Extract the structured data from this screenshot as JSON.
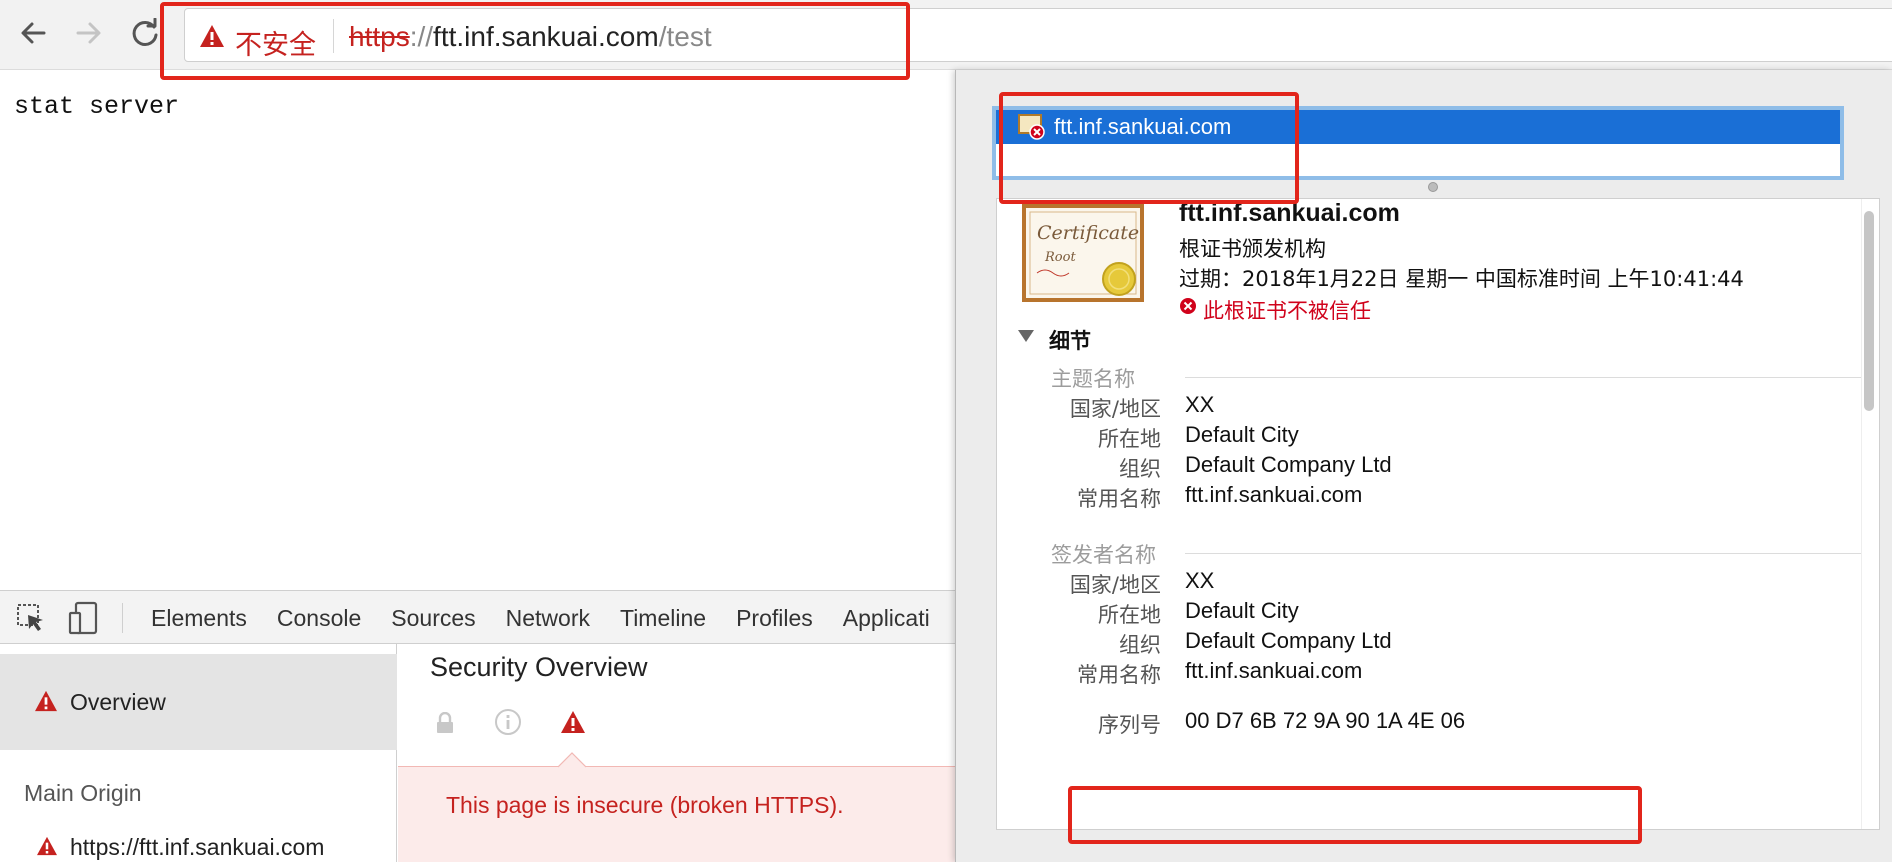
{
  "browser": {
    "security_label": "不安全",
    "url_scheme": "https",
    "url_separator": "://",
    "url_host": "ftt.inf.sankuai.com",
    "url_path": "/test"
  },
  "page": {
    "body_text": "stat server"
  },
  "devtools": {
    "tabs": [
      "Elements",
      "Console",
      "Sources",
      "Network",
      "Timeline",
      "Profiles",
      "Applicati"
    ],
    "sidebar": {
      "overview_label": "Overview",
      "main_origin_label": "Main Origin",
      "origin_url": "https://ftt.inf.sankuai.com"
    },
    "security": {
      "title": "Security Overview",
      "message": "This page is insecure (broken HTTPS)."
    }
  },
  "certificate": {
    "list_item": "ftt.inf.sankuai.com",
    "name": "ftt.inf.sankuai.com",
    "kind": "根证书颁发机构",
    "expiry": "过期：2018年1月22日 星期一 中国标准时间 上午10:41:44",
    "trust_status": "此根证书不被信任",
    "details_label": "细节",
    "subject": {
      "heading": "主题名称",
      "rows": [
        {
          "label": "国家/地区",
          "value": "XX"
        },
        {
          "label": "所在地",
          "value": "Default City"
        },
        {
          "label": "组织",
          "value": "Default Company Ltd"
        },
        {
          "label": "常用名称",
          "value": "ftt.inf.sankuai.com"
        }
      ]
    },
    "issuer": {
      "heading": "签发者名称",
      "rows": [
        {
          "label": "国家/地区",
          "value": "XX"
        },
        {
          "label": "所在地",
          "value": "Default City"
        },
        {
          "label": "组织",
          "value": "Default Company Ltd"
        },
        {
          "label": "常用名称",
          "value": "ftt.inf.sankuai.com"
        }
      ]
    },
    "serial": {
      "label": "序列号",
      "value": "00 D7 6B 72 9A 90 1A 4E 06"
    }
  },
  "colors": {
    "warning_red": "#c5221f",
    "selection_blue": "#1a6fd6",
    "annotation_red": "#e2251b"
  },
  "icons": [
    "back-arrow-icon",
    "forward-arrow-icon",
    "reload-icon",
    "warning-triangle-icon",
    "inspect-element-icon",
    "device-mode-icon",
    "lock-icon",
    "info-icon",
    "certificate-icon",
    "error-circle-icon",
    "disclosure-triangle-icon"
  ]
}
